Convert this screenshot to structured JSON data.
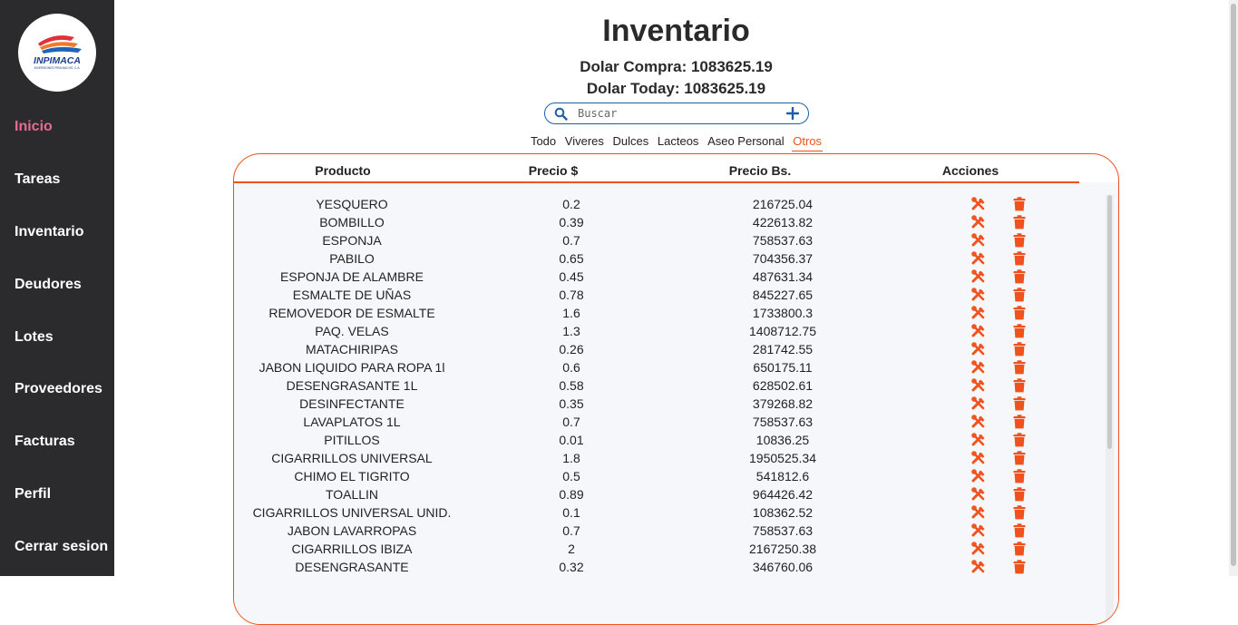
{
  "brand": {
    "logo_text": "INPIMACA",
    "logo_subtext": "INVERSIONES PIRA MACHO, C.A."
  },
  "sidebar": {
    "items": [
      {
        "label": "Inicio",
        "active": true
      },
      {
        "label": "Tareas"
      },
      {
        "label": "Inventario"
      },
      {
        "label": "Deudores"
      },
      {
        "label": "Lotes"
      },
      {
        "label": "Proveedores"
      },
      {
        "label": "Facturas"
      },
      {
        "label": "Perfil"
      },
      {
        "label": "Cerrar sesion"
      }
    ]
  },
  "header": {
    "title": "Inventario",
    "dolar_compra": "Dolar Compra: 1083625.19",
    "dolar_today": "Dolar Today: 1083625.19"
  },
  "search": {
    "placeholder": "Buscar",
    "value": ""
  },
  "tabs": [
    "Todo",
    "Viveres",
    "Dulces",
    "Lacteos",
    "Aseo Personal",
    "Otros"
  ],
  "active_tab": "Otros",
  "table": {
    "headers": {
      "product": "Producto",
      "usd": "Precio $",
      "bs": "Precio Bs.",
      "actions": "Acciones"
    },
    "rows": [
      {
        "product": "YESQUERO",
        "usd": "0.2",
        "bs": "216725.04"
      },
      {
        "product": "BOMBILLO",
        "usd": "0.39",
        "bs": "422613.82"
      },
      {
        "product": "ESPONJA",
        "usd": "0.7",
        "bs": "758537.63"
      },
      {
        "product": "PABILO",
        "usd": "0.65",
        "bs": "704356.37"
      },
      {
        "product": "ESPONJA DE ALAMBRE",
        "usd": "0.45",
        "bs": "487631.34"
      },
      {
        "product": "ESMALTE DE UÑAS",
        "usd": "0.78",
        "bs": "845227.65"
      },
      {
        "product": "REMOVEDOR DE ESMALTE",
        "usd": "1.6",
        "bs": "1733800.3"
      },
      {
        "product": "PAQ. VELAS",
        "usd": "1.3",
        "bs": "1408712.75"
      },
      {
        "product": "MATACHIRIPAS",
        "usd": "0.26",
        "bs": "281742.55"
      },
      {
        "product": "JABON LIQUIDO PARA ROPA 1l",
        "usd": "0.6",
        "bs": "650175.11"
      },
      {
        "product": "DESENGRASANTE 1L",
        "usd": "0.58",
        "bs": "628502.61"
      },
      {
        "product": "DESINFECTANTE",
        "usd": "0.35",
        "bs": "379268.82"
      },
      {
        "product": "LAVAPLATOS 1L",
        "usd": "0.7",
        "bs": "758537.63"
      },
      {
        "product": "PITILLOS",
        "usd": "0.01",
        "bs": "10836.25"
      },
      {
        "product": "CIGARRILLOS UNIVERSAL",
        "usd": "1.8",
        "bs": "1950525.34"
      },
      {
        "product": "CHIMO EL TIGRITO",
        "usd": "0.5",
        "bs": "541812.6"
      },
      {
        "product": "TOALLIN",
        "usd": "0.89",
        "bs": "964426.42"
      },
      {
        "product": "CIGARRILLOS UNIVERSAL UNID.",
        "usd": "0.1",
        "bs": "108362.52"
      },
      {
        "product": "JABON LAVARROPAS",
        "usd": "0.7",
        "bs": "758537.63"
      },
      {
        "product": "CIGARRILLOS IBIZA",
        "usd": "2",
        "bs": "2167250.38"
      },
      {
        "product": "DESENGRASANTE",
        "usd": "0.32",
        "bs": "346760.06"
      }
    ]
  },
  "icons": {
    "search": "search-icon",
    "add": "plus-icon",
    "edit": "edit-tools-icon",
    "delete": "trash-icon"
  },
  "colors": {
    "accent": "#f0521e",
    "sidebar_bg": "#2b2b2d",
    "active_nav": "#e86a8f",
    "search_border": "#1e5fa8"
  }
}
